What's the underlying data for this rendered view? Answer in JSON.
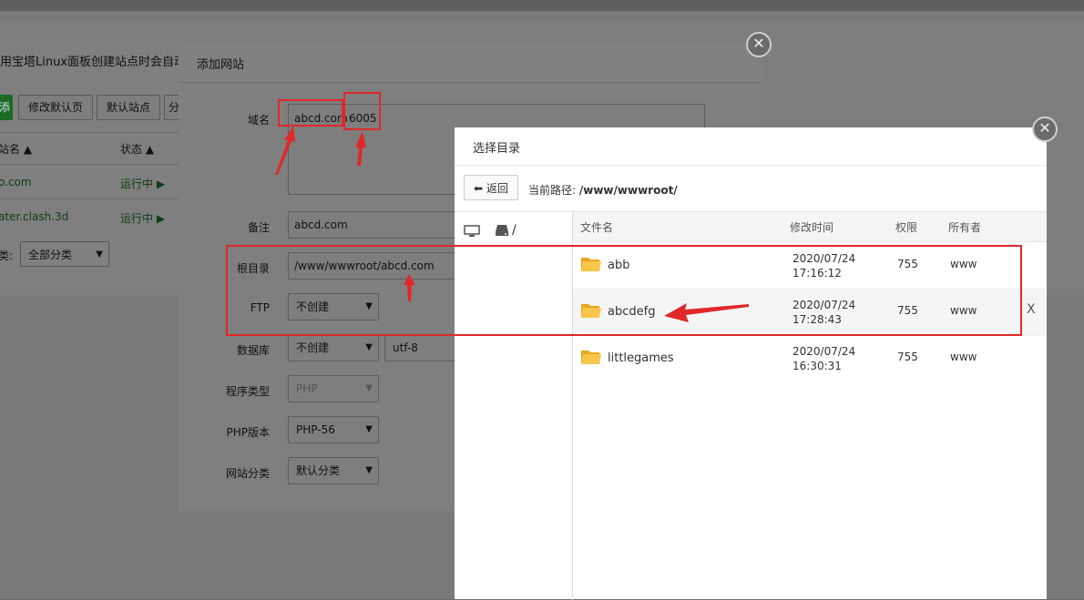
{
  "background": {
    "notice": "用宝塔Linux面板创建站点时会自动创建",
    "buttons": [
      "添",
      "修改默认页",
      "默认站点",
      "分"
    ],
    "table_headers": {
      "site": "站名",
      "status": "状态"
    },
    "sites": [
      {
        "name": "o.com",
        "status": "运行中"
      },
      {
        "name": "ater.clash.3d",
        "status": "运行中"
      }
    ],
    "category_label": "类:",
    "category_value": "全部分类"
  },
  "add_site": {
    "title": "添加网站",
    "domain_label": "域名",
    "domain_value": "abcd.com",
    "domain_port": "6005",
    "note_label": "备注",
    "note_value": "abcd.com",
    "root_label": "根目录",
    "root_value": "/www/wwwroot/abcd.com",
    "ftp_label": "FTP",
    "ftp_value": "不创建",
    "db_label": "数据库",
    "db_value": "不创建",
    "db_charset": "utf-8",
    "program_label": "程序类型",
    "program_value": "PHP",
    "php_label": "PHP版本",
    "php_value": "PHP-56",
    "category_label": "网站分类",
    "category_value": "默认分类"
  },
  "dir_dialog": {
    "title": "选择目录",
    "back_label": "返回",
    "path_prefix": "当前路径:",
    "path_value": "/www/wwwroot/",
    "tree_root": "/",
    "columns": {
      "name": "文件名",
      "mtime": "修改时间",
      "perm": "权限",
      "owner": "所有者"
    },
    "rows": [
      {
        "name": "abb",
        "date": "2020/07/24",
        "time": "17:16:12",
        "perm": "755",
        "owner": "www"
      },
      {
        "name": "abcdefg",
        "date": "2020/07/24",
        "time": "17:28:43",
        "perm": "755",
        "owner": "www",
        "action": "X"
      },
      {
        "name": "littlegames",
        "date": "2020/07/24",
        "time": "16:30:31",
        "perm": "755",
        "owner": "www"
      }
    ]
  },
  "colors": {
    "highlight": "#e0282a",
    "folder": "#f5bf3a",
    "overlay": "#7a7a7a"
  }
}
